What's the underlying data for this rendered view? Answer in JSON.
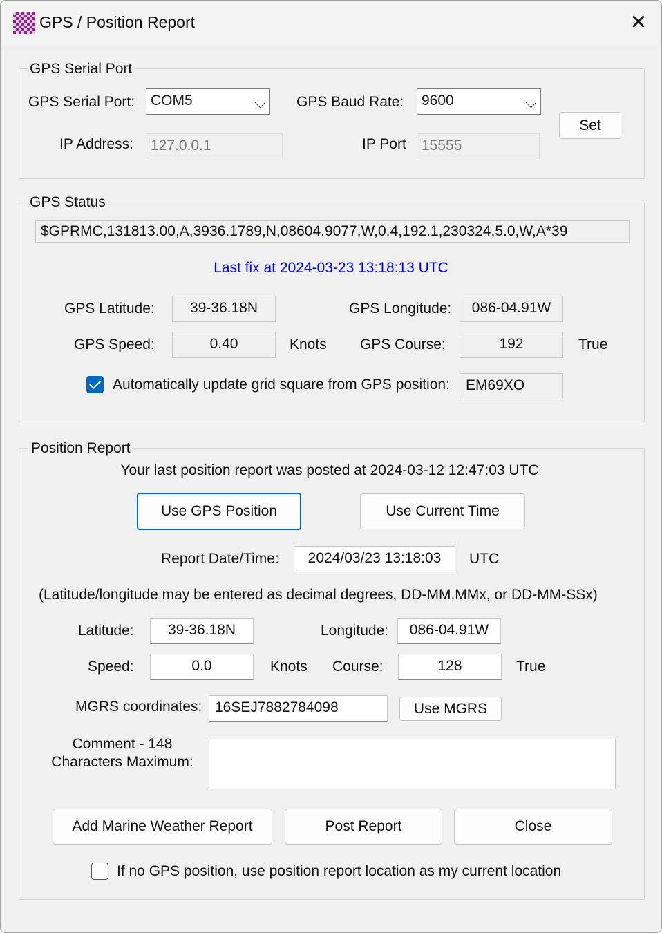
{
  "window": {
    "title": "GPS / Position Report",
    "close_glyph": "✕"
  },
  "serial": {
    "legend": "GPS Serial Port",
    "port_label": "GPS Serial Port:",
    "port_value": "COM5",
    "baud_label": "GPS Baud Rate:",
    "baud_value": "9600",
    "set_button": "Set",
    "ip_label": "IP Address:",
    "ip_value": "127.0.0.1",
    "ipport_label": "IP Port",
    "ipport_value": "15555"
  },
  "status": {
    "legend": "GPS Status",
    "nmea": "$GPRMC,131813.00,A,3936.1789,N,08604.9077,W,0.4,192.1,230324,5.0,W,A*39",
    "last_fix": "Last fix at 2024-03-23 13:18:13 UTC",
    "lat_label": "GPS Latitude:",
    "lat_value": "39-36.18N",
    "lon_label": "GPS Longitude:",
    "lon_value": "086-04.91W",
    "speed_label": "GPS Speed:",
    "speed_value": "0.40",
    "speed_unit": "Knots",
    "course_label": "GPS Course:",
    "course_value": "192",
    "course_unit": "True",
    "auto_grid_label": "Automatically update grid square from GPS position:",
    "auto_grid_checked": true,
    "grid_value": "EM69XO"
  },
  "report": {
    "legend": "Position Report",
    "last_posted": "Your last position report was posted at 2024-03-12 12:47:03 UTC",
    "use_gps_button": "Use GPS Position",
    "use_time_button": "Use Current Time",
    "datetime_label": "Report Date/Time:",
    "datetime_value": "2024/03/23 13:18:03",
    "datetime_unit": "UTC",
    "hint": "(Latitude/longitude may be entered as decimal degrees, DD-MM.MMx, or DD-MM-SSx)",
    "lat_label": "Latitude:",
    "lat_value": "39-36.18N",
    "lon_label": "Longitude:",
    "lon_value": "086-04.91W",
    "speed_label": "Speed:",
    "speed_value": "0.0",
    "speed_unit": "Knots",
    "course_label": "Course:",
    "course_value": "128",
    "course_unit": "True",
    "mgrs_label": "MGRS coordinates:",
    "mgrs_value": "16SEJ7882784098",
    "use_mgrs_button": "Use MGRS",
    "comment_label_1": "Comment - 148",
    "comment_label_2": "Characters Maximum:",
    "comment_value": "",
    "marine_button": "Add Marine Weather Report",
    "post_button": "Post Report",
    "close_button": "Close",
    "fallback_label": "If no GPS position, use position report location as my current location",
    "fallback_checked": false
  }
}
